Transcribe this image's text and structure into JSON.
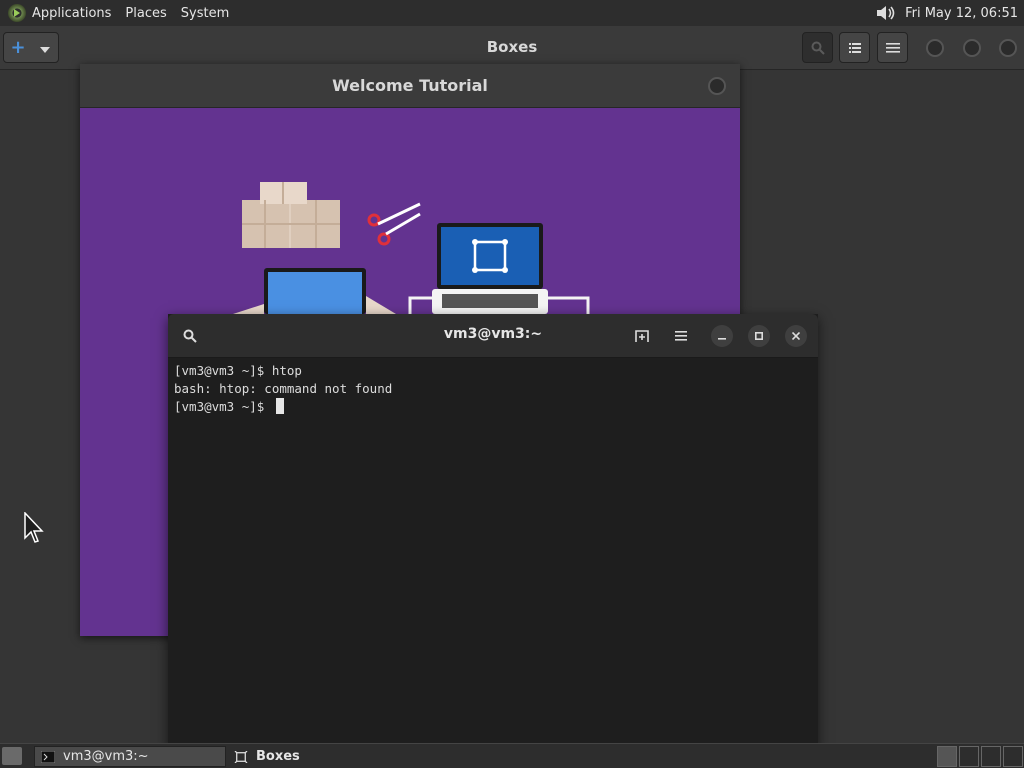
{
  "top_panel": {
    "menu": [
      "Applications",
      "Places",
      "System"
    ],
    "clock": "Fri May 12, 06:51"
  },
  "boxes": {
    "title": "Boxes"
  },
  "welcome": {
    "title": "Welcome Tutorial",
    "bg_color": "#633390"
  },
  "terminal": {
    "title": "vm3@vm3:~",
    "lines": [
      "[vm3@vm3 ~]$ htop",
      "bash: htop: command not found",
      "[vm3@vm3 ~]$ "
    ]
  },
  "taskbar": {
    "tasks": [
      "vm3@vm3:~",
      "Boxes"
    ]
  },
  "colors": {
    "accent": "#4a90d9",
    "terminal_bg": "#1e1e1e"
  }
}
